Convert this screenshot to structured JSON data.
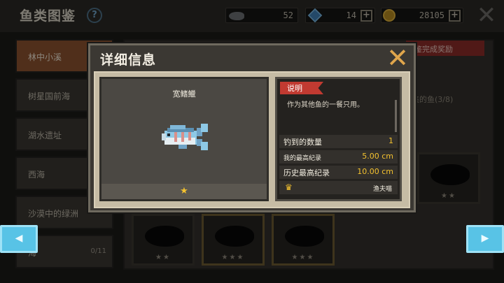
{
  "header": {
    "title": "鱼类图鉴",
    "help": "?",
    "fish_count": "52",
    "gems": "14",
    "coins": "28105",
    "plus": "+",
    "close": "✕"
  },
  "sidebar": {
    "items": [
      {
        "label": "林中小溪",
        "count": ""
      },
      {
        "label": "树星国前海",
        "count": ""
      },
      {
        "label": "湖水遗址",
        "count": ""
      },
      {
        "label": "西海",
        "count": ""
      },
      {
        "label": "沙漠中的绿洲",
        "count": ""
      },
      {
        "label": "海",
        "count": "0/11"
      }
    ]
  },
  "reward": {
    "banner": "鉴完成奖励",
    "progress_text": "集的鱼(3/8)"
  },
  "cards": [
    {
      "stars": "★★"
    },
    {
      "stars": "★★★"
    },
    {
      "stars": "★★★"
    },
    {
      "stars": "★★"
    }
  ],
  "nav": {
    "left": "◀",
    "right": "▶"
  },
  "modal": {
    "title": "详细信息",
    "close": "✕",
    "fish_name": "宽鳍鱲",
    "fish_stars": "★",
    "desc_label": "说明",
    "description": "作为其他鱼的一餐只用。",
    "caught_label": "钓到的数量",
    "caught_value": "1",
    "my_record_label": "我的最高纪录",
    "my_record_value": "5.00 cm",
    "history_label": "历史最高纪录",
    "history_value": "10.00 cm",
    "record_holder": "渔夫喵"
  },
  "colors": {
    "accent_red": "#c13a31",
    "star_gold": "#f4c22f",
    "nav_blue": "#58c3e6",
    "close_orange": "#e0a64c"
  }
}
